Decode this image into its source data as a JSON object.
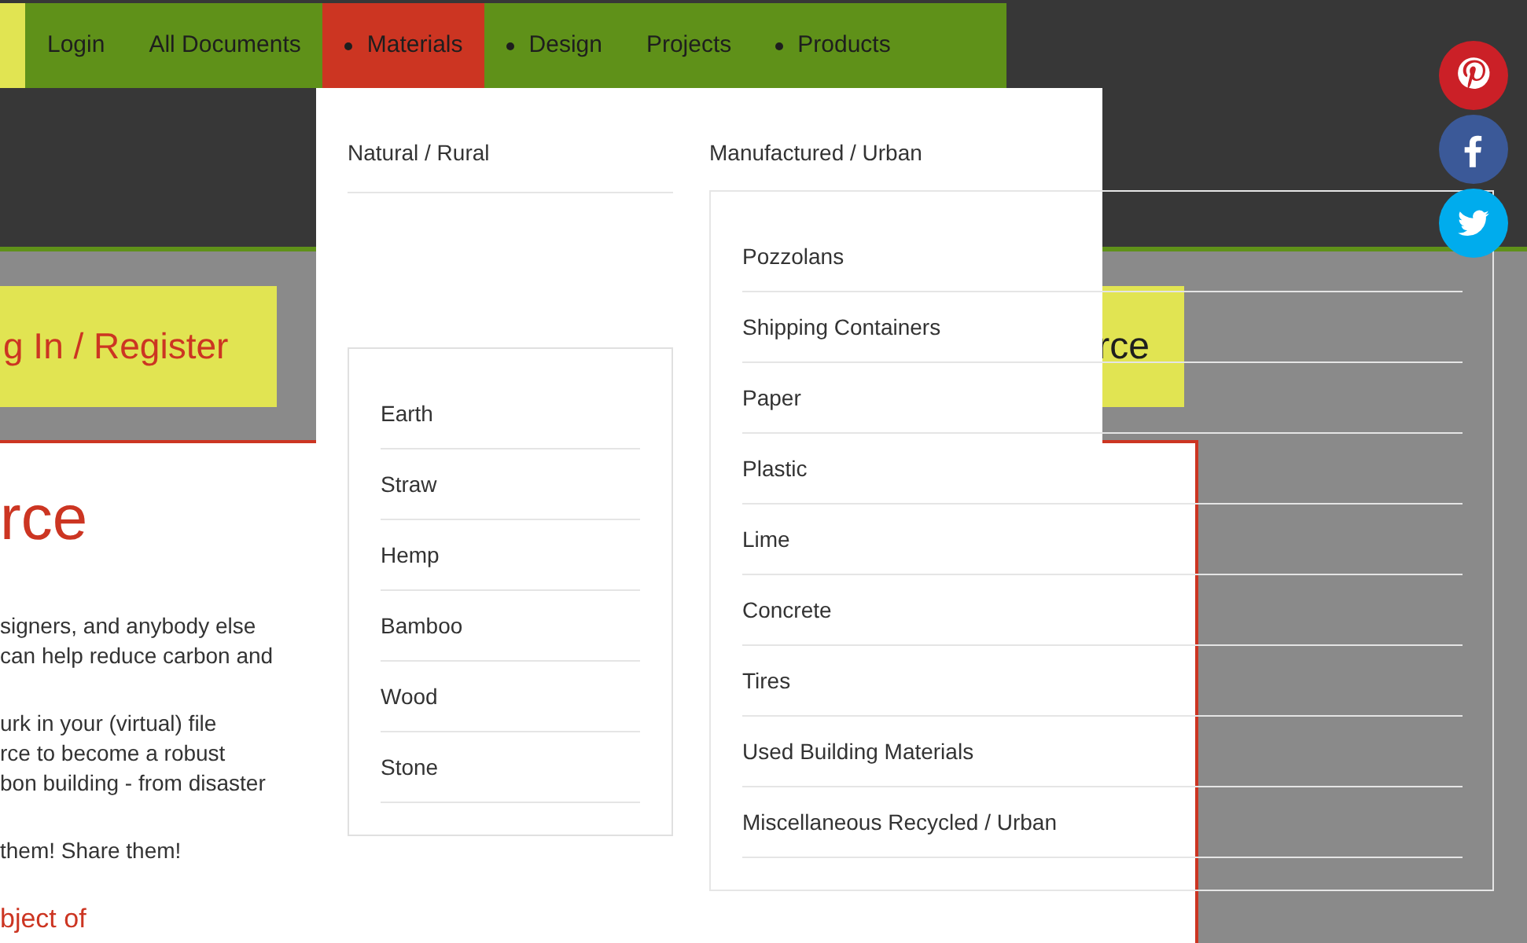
{
  "nav": {
    "items": [
      {
        "label": "Login",
        "has_submenu": false,
        "selected": false
      },
      {
        "label": "All Documents",
        "has_submenu": false,
        "selected": false
      },
      {
        "label": "Materials",
        "has_submenu": true,
        "selected": true
      },
      {
        "label": "Design",
        "has_submenu": true,
        "selected": false
      },
      {
        "label": "Projects",
        "has_submenu": false,
        "selected": false
      },
      {
        "label": "Products",
        "has_submenu": true,
        "selected": false
      }
    ]
  },
  "banner_buttons": [
    "g In / Register",
    "rce"
  ],
  "content": {
    "heading": "rce",
    "paragraphs": [
      {
        "lines": [
          "signers, and anybody else",
          "can help reduce carbon and"
        ],
        "kind": "text"
      },
      {
        "lines": [
          "urk in your (virtual) file",
          "rce to become a robust",
          "bon building - from disaster"
        ],
        "kind": "text"
      },
      {
        "lines": [
          "them! Share them!"
        ],
        "kind": "text"
      },
      {
        "lines": [
          "bject of"
        ],
        "kind": "highlight"
      }
    ]
  },
  "dropdown": {
    "columns": [
      {
        "title": "Natural / Rural",
        "items": [
          "Earth",
          "Straw",
          "Hemp",
          "Bamboo",
          "Wood",
          "Stone"
        ]
      },
      {
        "title": "Manufactured / Urban",
        "items": [
          "Pozzolans",
          "Shipping Containers",
          "Paper",
          "Plastic",
          "Lime",
          "Concrete",
          "Tires",
          "Used Building Materials",
          "Miscellaneous Recycled / Urban"
        ]
      }
    ]
  },
  "social": [
    {
      "kind": "pinterest"
    },
    {
      "kind": "facebook"
    },
    {
      "kind": "twitter"
    }
  ]
}
